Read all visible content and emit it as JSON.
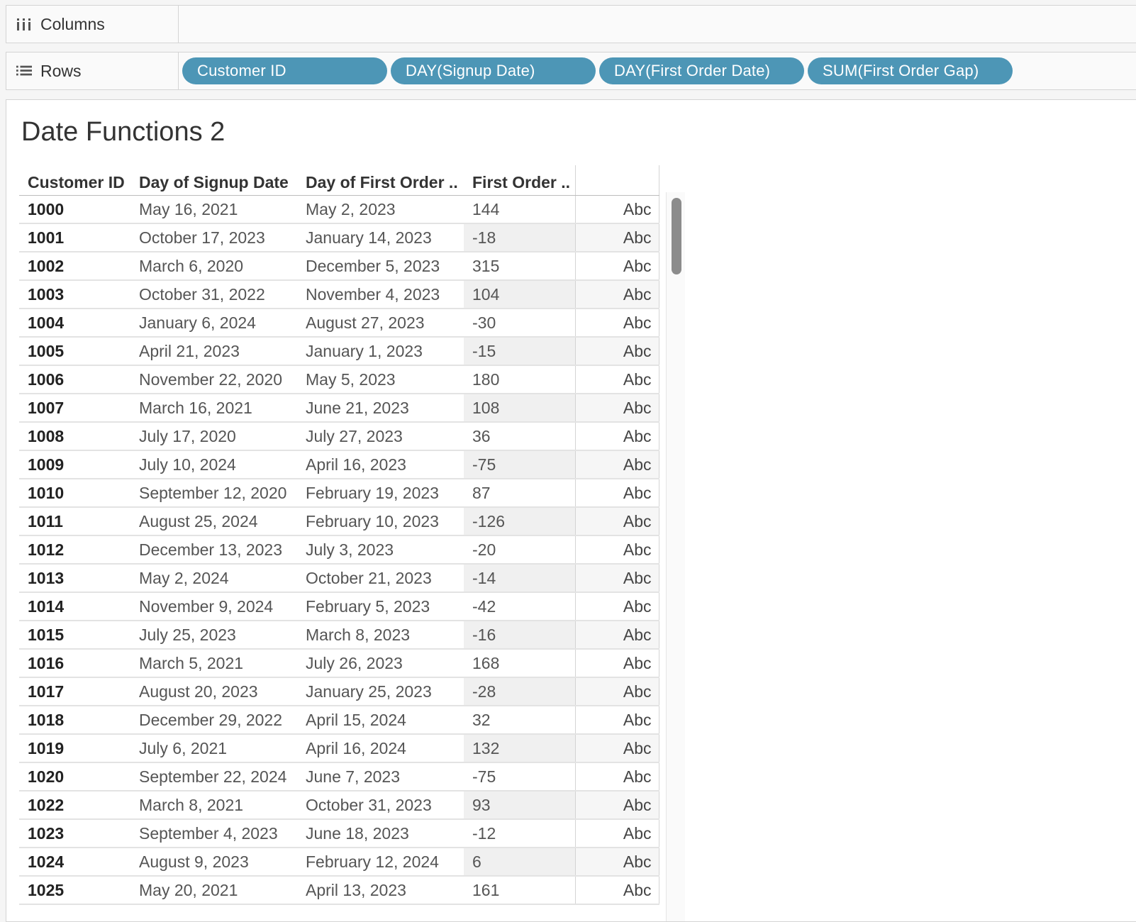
{
  "shelves": {
    "columns_label": "Columns",
    "rows_label": "Rows",
    "row_pills": [
      "Customer ID",
      "DAY(Signup Date)",
      "DAY(First Order Date)",
      "SUM(First Order Gap)"
    ]
  },
  "sheet": {
    "title": "Date Functions 2",
    "headers": [
      "Customer ID",
      "Day of Signup Date",
      "Day of First Order ..",
      "First Order .."
    ],
    "rows": [
      [
        "1000",
        "May 16, 2021",
        "May 2, 2023",
        "144",
        "Abc"
      ],
      [
        "1001",
        "October 17, 2023",
        "January 14, 2023",
        "-18",
        "Abc"
      ],
      [
        "1002",
        "March 6, 2020",
        "December 5, 2023",
        "315",
        "Abc"
      ],
      [
        "1003",
        "October 31, 2022",
        "November 4, 2023",
        "104",
        "Abc"
      ],
      [
        "1004",
        "January 6, 2024",
        "August 27, 2023",
        "-30",
        "Abc"
      ],
      [
        "1005",
        "April 21, 2023",
        "January 1, 2023",
        "-15",
        "Abc"
      ],
      [
        "1006",
        "November 22, 2020",
        "May 5, 2023",
        "180",
        "Abc"
      ],
      [
        "1007",
        "March 16, 2021",
        "June 21, 2023",
        "108",
        "Abc"
      ],
      [
        "1008",
        "July 17, 2020",
        "July 27, 2023",
        "36",
        "Abc"
      ],
      [
        "1009",
        "July 10, 2024",
        "April 16, 2023",
        "-75",
        "Abc"
      ],
      [
        "1010",
        "September 12, 2020",
        "February 19, 2023",
        "87",
        "Abc"
      ],
      [
        "1011",
        "August 25, 2024",
        "February 10, 2023",
        "-126",
        "Abc"
      ],
      [
        "1012",
        "December 13, 2023",
        "July 3, 2023",
        "-20",
        "Abc"
      ],
      [
        "1013",
        "May 2, 2024",
        "October 21, 2023",
        "-14",
        "Abc"
      ],
      [
        "1014",
        "November 9, 2024",
        "February 5, 2023",
        "-42",
        "Abc"
      ],
      [
        "1015",
        "July 25, 2023",
        "March 8, 2023",
        "-16",
        "Abc"
      ],
      [
        "1016",
        "March 5, 2021",
        "July 26, 2023",
        "168",
        "Abc"
      ],
      [
        "1017",
        "August 20, 2023",
        "January 25, 2023",
        "-28",
        "Abc"
      ],
      [
        "1018",
        "December 29, 2022",
        "April 15, 2024",
        "32",
        "Abc"
      ],
      [
        "1019",
        "July 6, 2021",
        "April 16, 2024",
        "132",
        "Abc"
      ],
      [
        "1020",
        "September 22, 2024",
        "June 7, 2023",
        "-75",
        "Abc"
      ],
      [
        "1022",
        "March 8, 2021",
        "October 31, 2023",
        "93",
        "Abc"
      ],
      [
        "1023",
        "September 4, 2023",
        "June 18, 2023",
        "-12",
        "Abc"
      ],
      [
        "1024",
        "August 9, 2023",
        "February 12, 2024",
        "6",
        "Abc"
      ],
      [
        "1025",
        "May 20, 2021",
        "April 13, 2023",
        "161",
        "Abc"
      ]
    ]
  },
  "colors": {
    "pill": "#4d96b6",
    "background": "#f5f5f5"
  },
  "icons": {
    "columns": "columns-icon",
    "rows": "rows-icon"
  }
}
